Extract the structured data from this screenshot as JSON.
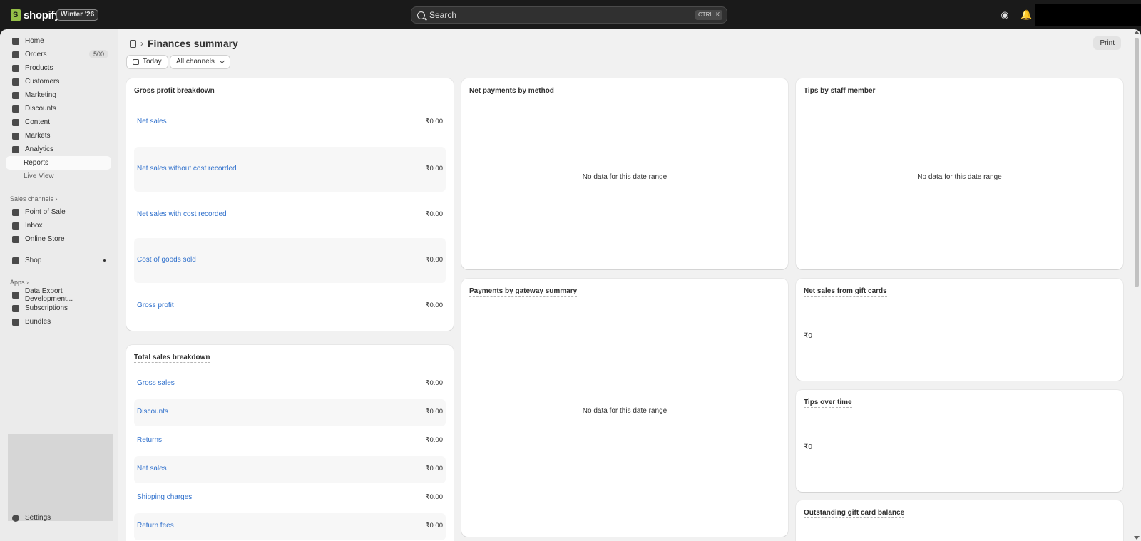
{
  "topbar": {
    "brand": "shopify",
    "edition_badge": "Winter '26",
    "search_label": "Search",
    "shortcut_ctrl": "CTRL",
    "shortcut_key": "K"
  },
  "sidebar": {
    "items": [
      {
        "label": "Home",
        "icon": "home-icon"
      },
      {
        "label": "Orders",
        "icon": "orders-icon",
        "count": "500"
      },
      {
        "label": "Products",
        "icon": "tag-icon"
      },
      {
        "label": "Customers",
        "icon": "person-icon"
      },
      {
        "label": "Marketing",
        "icon": "target-icon"
      },
      {
        "label": "Discounts",
        "icon": "discount-icon"
      },
      {
        "label": "Content",
        "icon": "content-icon"
      },
      {
        "label": "Markets",
        "icon": "globe-icon"
      },
      {
        "label": "Analytics",
        "icon": "bar-chart-icon"
      },
      {
        "label": "Reports"
      },
      {
        "label": "Live View"
      }
    ],
    "sales_channels_label": "Sales channels",
    "sales_channels": [
      {
        "label": "Point of Sale",
        "icon": "pos-icon"
      },
      {
        "label": "Inbox",
        "icon": "inbox-icon"
      },
      {
        "label": "Online Store",
        "icon": "store-icon"
      }
    ],
    "shop_label": "Shop",
    "apps_label": "Apps",
    "apps": [
      {
        "label": "Data Export Development..."
      },
      {
        "label": "Subscriptions"
      },
      {
        "label": "Bundles"
      }
    ],
    "settings_label": "Settings"
  },
  "header": {
    "title": "Finances summary",
    "print_label": "Print",
    "date_filter": "Today",
    "channel_filter": "All channels"
  },
  "gross_profit": {
    "title": "Gross profit breakdown",
    "rows": [
      {
        "label": "Net sales",
        "value": "₹0.00"
      },
      {
        "label": "Net sales without cost recorded",
        "value": "₹0.00"
      },
      {
        "label": "Net sales with cost recorded",
        "value": "₹0.00"
      },
      {
        "label": "Cost of goods sold",
        "value": "₹0.00"
      },
      {
        "label": "Gross profit",
        "value": "₹0.00"
      }
    ]
  },
  "total_sales": {
    "title": "Total sales breakdown",
    "rows": [
      {
        "label": "Gross sales",
        "value": "₹0.00"
      },
      {
        "label": "Discounts",
        "value": "₹0.00"
      },
      {
        "label": "Returns",
        "value": "₹0.00"
      },
      {
        "label": "Net sales",
        "value": "₹0.00"
      },
      {
        "label": "Shipping charges",
        "value": "₹0.00"
      },
      {
        "label": "Return fees",
        "value": "₹0.00"
      }
    ]
  },
  "net_payments": {
    "title": "Net payments by method",
    "empty": "No data for this date range"
  },
  "gateway_summary": {
    "title": "Payments by gateway summary",
    "empty": "No data for this date range"
  },
  "tips_staff": {
    "title": "Tips by staff member",
    "empty": "No data for this date range"
  },
  "gift_cards": {
    "title": "Net sales from gift cards",
    "value": "₹0"
  },
  "tips_time": {
    "title": "Tips over time",
    "value": "₹0"
  },
  "outstanding": {
    "title": "Outstanding gift card balance"
  }
}
